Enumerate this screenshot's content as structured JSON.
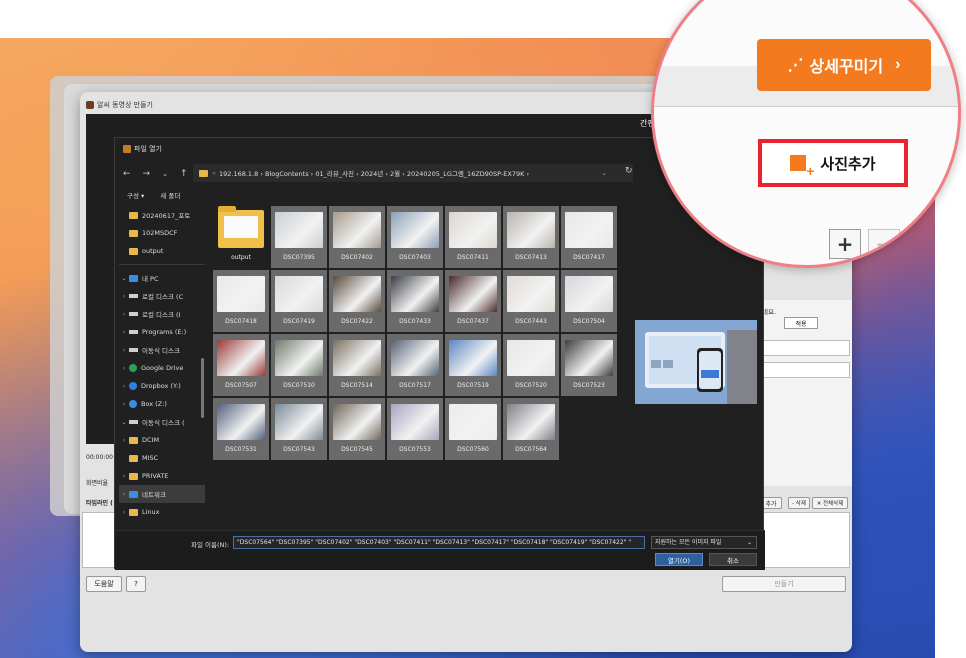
{
  "app": {
    "title": "알씨 동영상 만들기",
    "simplify_tab": "간편",
    "time": "00:00:00",
    "ratio_label": "화면비율",
    "timeline_label": "타임라인 (",
    "apply_btn": "적용",
    "text_label_right": "네요.",
    "add_btn_small": "추가",
    "delete_btn": "- 삭제",
    "delete_all_btn": "✕ 전체삭제",
    "help_btn": "도움말",
    "question_btn": "?",
    "make_btn": "만들기"
  },
  "dialog": {
    "title": "파일 열기",
    "address": [
      "192.168.1.8",
      "BlogContents",
      "01_리뷰_사진",
      "2024년",
      "2월",
      "20240205_LG그램_16ZD90SP-EX79K"
    ],
    "toolbar": {
      "organize": "구성 ▾",
      "new_folder": "새 폴더"
    },
    "sidebar": [
      {
        "label": "20240617_포토",
        "kind": "folder",
        "chev": ""
      },
      {
        "label": "102MSDCF",
        "kind": "folder",
        "chev": ""
      },
      {
        "label": "output",
        "kind": "folder",
        "chev": ""
      },
      {
        "label": "",
        "kind": "sep",
        "chev": ""
      },
      {
        "label": "내 PC",
        "kind": "pc",
        "chev": "⌄"
      },
      {
        "label": "로컬 디스크 (C",
        "kind": "drive",
        "chev": "›"
      },
      {
        "label": "로컬 디스크 (I",
        "kind": "drive",
        "chev": "›"
      },
      {
        "label": "Programs (E:)",
        "kind": "drive",
        "chev": "›"
      },
      {
        "label": "이동식 디스크",
        "kind": "drive",
        "chev": "›"
      },
      {
        "label": "Google Drive",
        "kind": "gdrive",
        "chev": "›"
      },
      {
        "label": "Dropbox (Y:)",
        "kind": "dropbox",
        "chev": "›"
      },
      {
        "label": "Box (Z:)",
        "kind": "box",
        "chev": "›"
      },
      {
        "label": "이동식 디스크 (",
        "kind": "drive",
        "chev": "⌄"
      },
      {
        "label": "DCIM",
        "kind": "folder",
        "chev": "›"
      },
      {
        "label": "MISC",
        "kind": "folder",
        "chev": ""
      },
      {
        "label": "PRIVATE",
        "kind": "folder",
        "chev": "›"
      },
      {
        "label": "네트워크",
        "kind": "network",
        "chev": "›"
      },
      {
        "label": "Linux",
        "kind": "folder",
        "chev": "›"
      }
    ],
    "files": [
      {
        "name": "output",
        "folder": true,
        "thumb": ""
      },
      {
        "name": "DSC07395",
        "thumb": "#c9cfd4"
      },
      {
        "name": "DSC07402",
        "thumb": "#a69b8c"
      },
      {
        "name": "DSC07403",
        "thumb": "#8aa0b7"
      },
      {
        "name": "DSC07411",
        "thumb": "#dcd6cf"
      },
      {
        "name": "DSC07413",
        "thumb": "#b9b3ab"
      },
      {
        "name": "DSC07417",
        "thumb": "#e8e8e6"
      },
      {
        "name": "DSC07418",
        "thumb": "#e9e9ea"
      },
      {
        "name": "DSC07419",
        "thumb": "#d9d9d9"
      },
      {
        "name": "DSC07422",
        "thumb": "#5a4a3c"
      },
      {
        "name": "DSC07433",
        "thumb": "#3b3f46"
      },
      {
        "name": "DSC07437",
        "thumb": "#4b2a2a"
      },
      {
        "name": "DSC07443",
        "thumb": "#e1dcd4"
      },
      {
        "name": "DSC07504",
        "thumb": "#d4d7dc"
      },
      {
        "name": "DSC07507",
        "thumb": "#9a3a38"
      },
      {
        "name": "DSC07510",
        "thumb": "#6d7c6a"
      },
      {
        "name": "DSC07514",
        "thumb": "#7a7060"
      },
      {
        "name": "DSC07517",
        "thumb": "#556274"
      },
      {
        "name": "DSC07519",
        "thumb": "#5a87c4"
      },
      {
        "name": "DSC07520",
        "thumb": "#e6e6e4"
      },
      {
        "name": "DSC07523",
        "thumb": "#3e3e40"
      },
      {
        "name": "DSC07531",
        "thumb": "#50607a"
      },
      {
        "name": "DSC07543",
        "thumb": "#7b8a96"
      },
      {
        "name": "DSC07545",
        "thumb": "#6f6658"
      },
      {
        "name": "DSC07553",
        "thumb": "#a8a4c0"
      },
      {
        "name": "DSC07560",
        "thumb": "#ececec"
      },
      {
        "name": "DSC07564",
        "thumb": "#7c7f86"
      }
    ],
    "filename_label": "파일 이름(N):",
    "filename_value": "\"DSC07564\" \"DSC07395\" \"DSC07402\" \"DSC07403\" \"DSC07411\" \"DSC07413\" \"DSC07417\" \"DSC07418\" \"DSC07419\" \"DSC07422\" \"",
    "filetype_value": "지원하는 모든 이미지 파일",
    "open_btn": "열기(O)",
    "cancel_btn": "취소"
  },
  "zoom": {
    "decorate_btn": "상세꾸미기",
    "photo_add": "사진추가",
    "plus": "+",
    "minus": "−"
  },
  "colors": {
    "accent_orange": "#f37a1f",
    "highlight_red": "#e8242f",
    "callout_pink": "#f07e86",
    "dialog_bg": "#202020"
  }
}
